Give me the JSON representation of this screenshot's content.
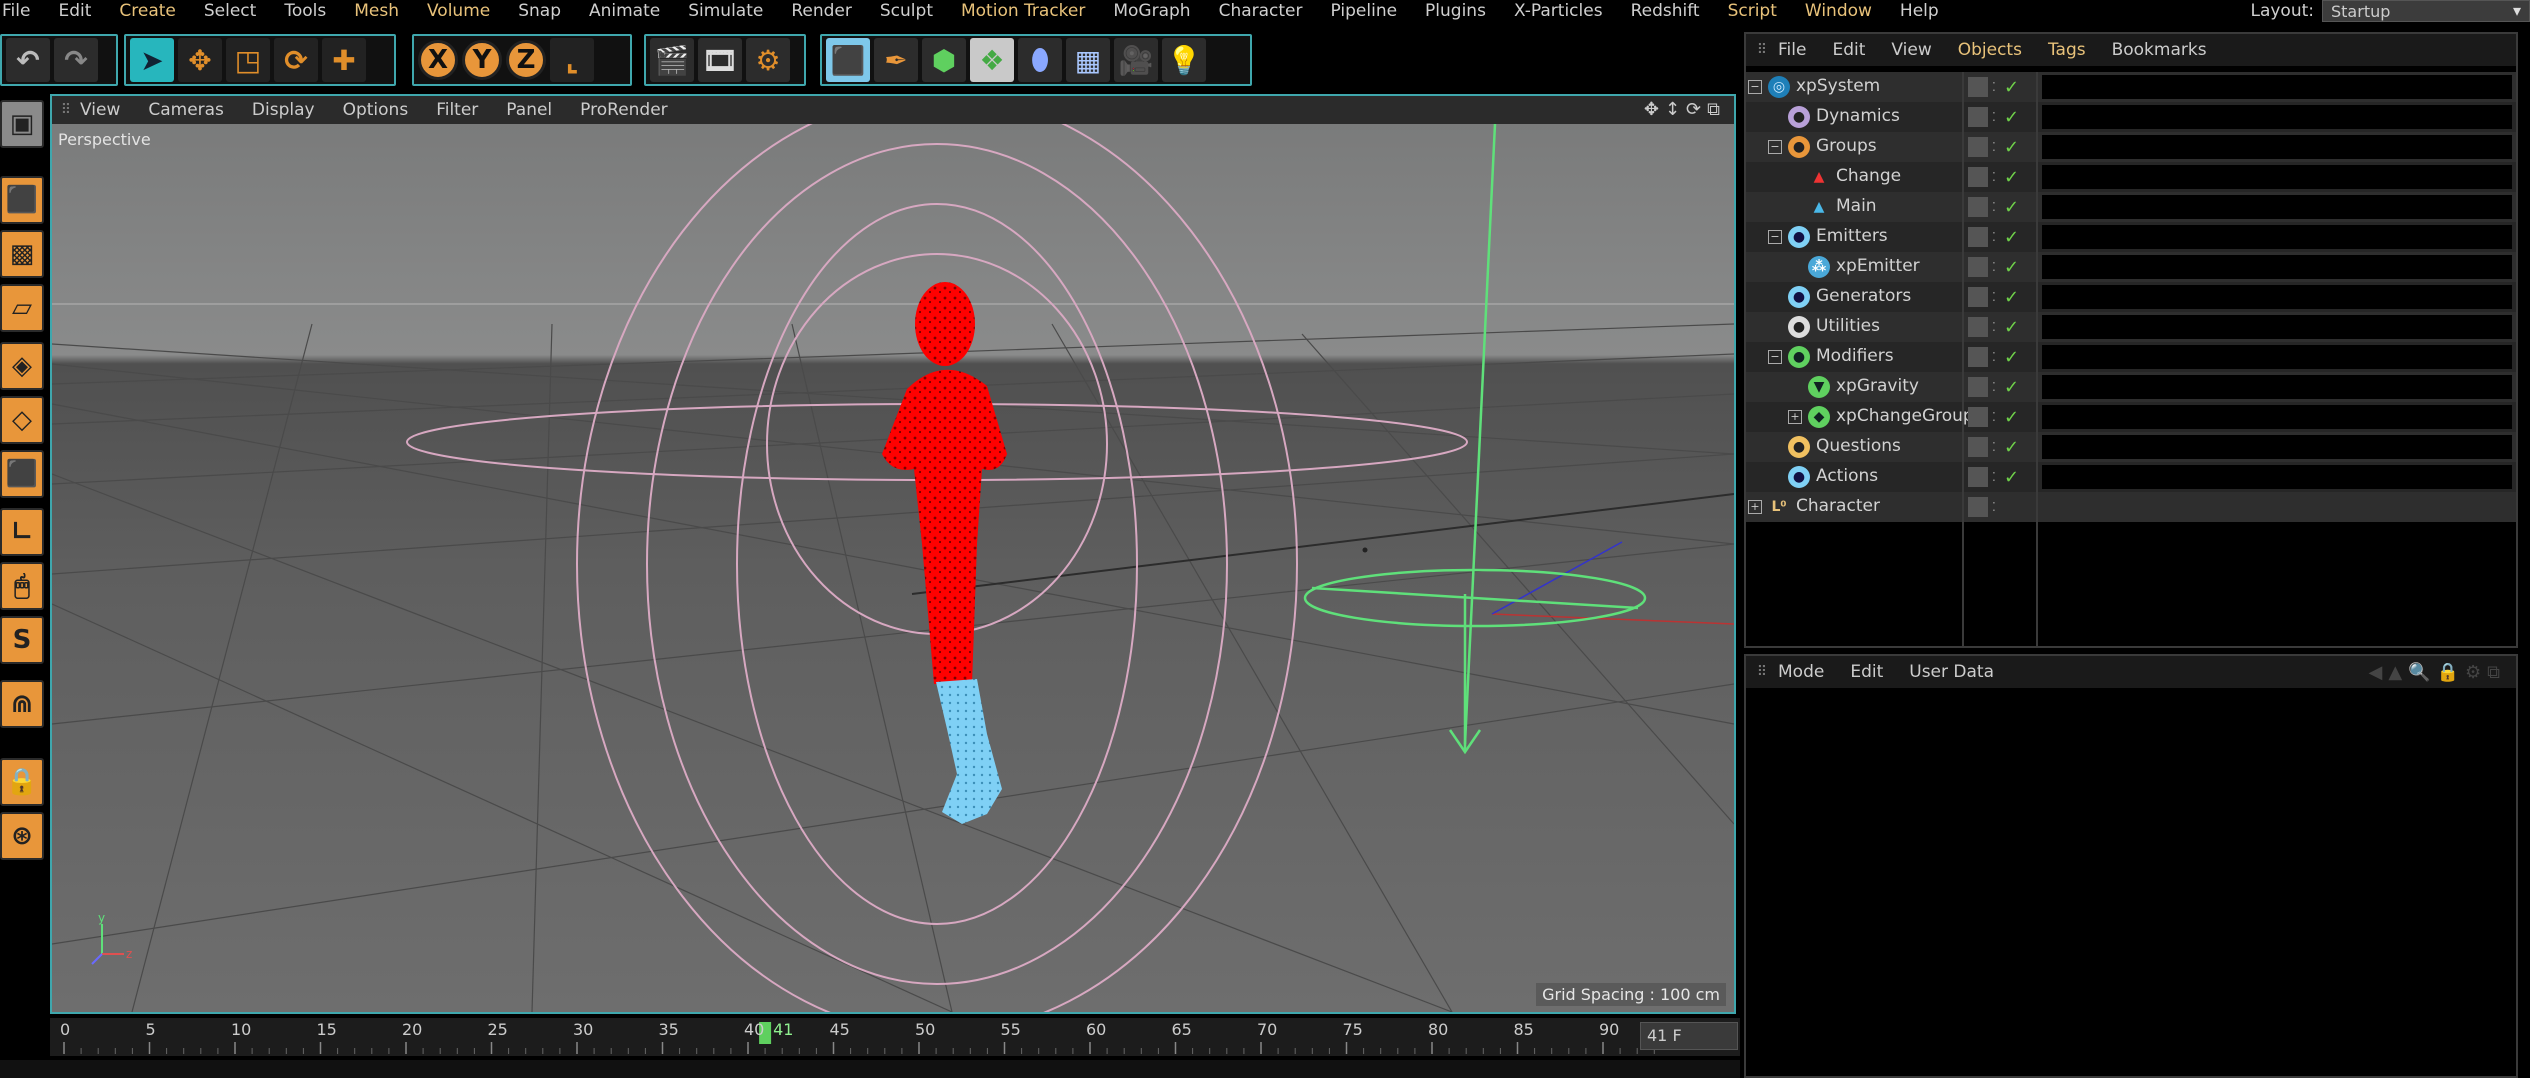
{
  "menu": [
    "File",
    "Edit",
    "Create",
    "Select",
    "Tools",
    "Mesh",
    "Volume",
    "Snap",
    "Animate",
    "Simulate",
    "Render",
    "Sculpt",
    "Motion Tracker",
    "MoGraph",
    "Character",
    "Pipeline",
    "Plugins",
    "X-Particles",
    "Redshift",
    "Script",
    "Window",
    "Help"
  ],
  "layout": {
    "label": "Layout:",
    "value": "Startup"
  },
  "viewport": {
    "menu": [
      "View",
      "Cameras",
      "Display",
      "Options",
      "Filter",
      "Panel",
      "ProRender"
    ],
    "camera_label": "Perspective",
    "grid_spacing": "Grid Spacing : 100 cm"
  },
  "timeline": {
    "ticks": [
      "0",
      "5",
      "10",
      "15",
      "20",
      "25",
      "30",
      "35",
      "40",
      "45",
      "50",
      "55",
      "60",
      "65",
      "70",
      "75",
      "80",
      "85",
      "90"
    ],
    "current_frame": "41",
    "frame_field": "41 F"
  },
  "object_manager": {
    "menu": [
      "File",
      "Edit",
      "View",
      "Objects",
      "Tags",
      "Bookmarks"
    ],
    "objects": [
      {
        "name": "xpSystem",
        "level": 0,
        "expander": "⊟",
        "icon": "system"
      },
      {
        "name": "Dynamics",
        "level": 1,
        "expander": "",
        "icon": "dyn"
      },
      {
        "name": "Groups",
        "level": 1,
        "expander": "⊟",
        "icon": "group"
      },
      {
        "name": "Change",
        "level": 2,
        "expander": "",
        "icon": "change"
      },
      {
        "name": "Main",
        "level": 2,
        "expander": "",
        "icon": "main"
      },
      {
        "name": "Emitters",
        "level": 1,
        "expander": "⊟",
        "icon": "emitters"
      },
      {
        "name": "xpEmitter",
        "level": 2,
        "expander": "",
        "icon": "emitter"
      },
      {
        "name": "Generators",
        "level": 1,
        "expander": "",
        "icon": "gen"
      },
      {
        "name": "Utilities",
        "level": 1,
        "expander": "",
        "icon": "util"
      },
      {
        "name": "Modifiers",
        "level": 1,
        "expander": "⊟",
        "icon": "mod"
      },
      {
        "name": "xpGravity",
        "level": 2,
        "expander": "",
        "icon": "gravity"
      },
      {
        "name": "xpChangeGroup",
        "level": 2,
        "expander": "⊞",
        "icon": "changegroup"
      },
      {
        "name": "Questions",
        "level": 1,
        "expander": "",
        "icon": "questions"
      },
      {
        "name": "Actions",
        "level": 1,
        "expander": "",
        "icon": "actions"
      },
      {
        "name": "Character",
        "level": 0,
        "expander": "⊞",
        "icon": "character"
      }
    ]
  },
  "attribute_manager": {
    "menu": [
      "Mode",
      "Edit",
      "User Data"
    ]
  },
  "colors": {
    "accent": "#3fa7ad",
    "tool_orange": "#e8963a",
    "particles_red": "#ff0000",
    "particles_blue": "#7fd0f5",
    "menu_highlight": "#e8c27a"
  }
}
